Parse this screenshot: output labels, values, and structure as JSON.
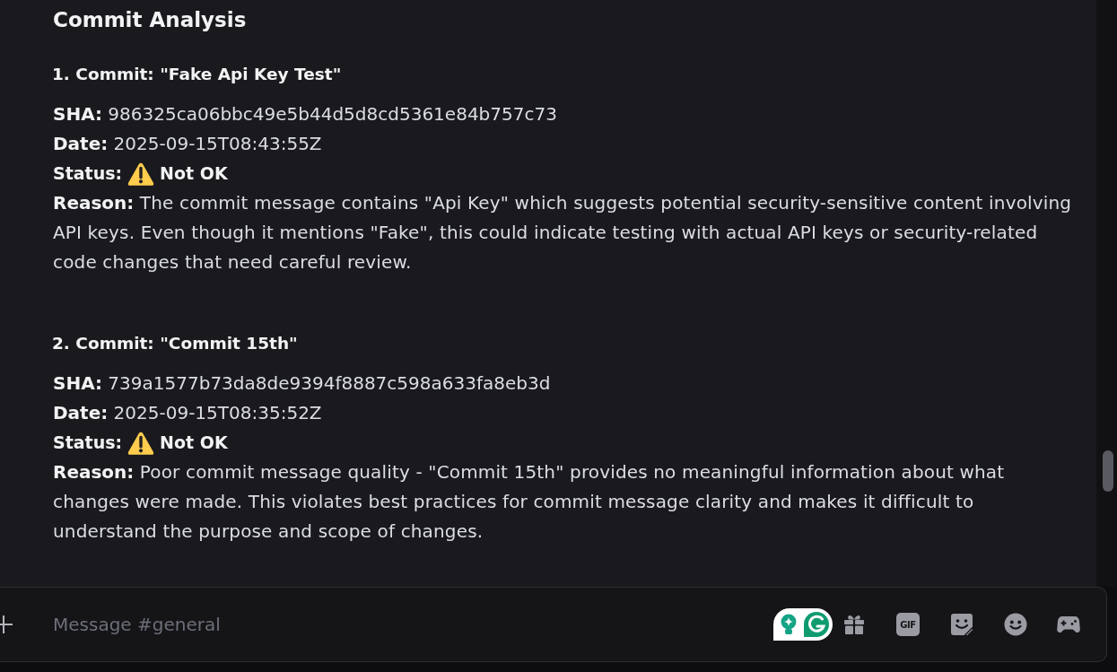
{
  "heading": "Commit Analysis",
  "commits": [
    {
      "title": "1. Commit: \"Fake Api Key Test\"",
      "sha": "**SHA:** 986325ca06bbc49e5b44d5d8cd5361e84b757c73",
      "date": "**Date:** 2025-09-15T08:43:55Z",
      "status": {
        "label": "Status:",
        "kind": "warning",
        "value": "Not OK"
      },
      "reason": "**Reason:** The commit message contains \"Api Key\" which suggests potential security-sensitive content involving API keys. Even though it mentions \"Fake\", this could indicate testing with actual API keys or security-related code changes that need careful review."
    },
    {
      "title": "2. Commit: \"Commit 15th\"",
      "sha": "**SHA:** 739a1577b73da8de9394f8887c598a633fa8eb3d",
      "date": "**Date:** 2025-09-15T08:35:52Z",
      "status": {
        "label": "Status:",
        "kind": "warning",
        "value": "Not OK"
      },
      "reason": "**Reason:** Poor commit message quality - \"Commit 15th\" provides no meaningful information about what changes were made. This violates best practices for commit message clarity and makes it difficult to understand the purpose and scope of changes."
    }
  ],
  "composer": {
    "placeholder": "Message #general",
    "gif_label": "GIF"
  }
}
